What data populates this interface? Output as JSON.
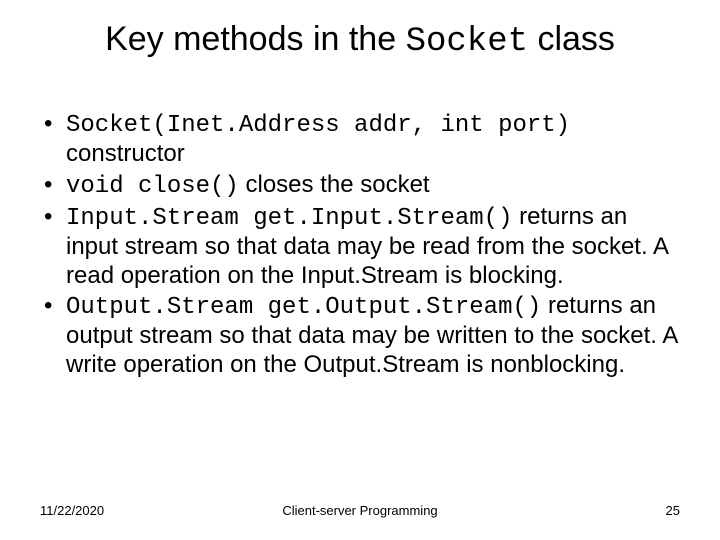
{
  "title": {
    "pre": "Key methods in the ",
    "code": "Socket",
    "post": " class"
  },
  "bullets": [
    {
      "code": "Socket(Inet.Address addr, int port)",
      "text": " constructor"
    },
    {
      "code": "void close()",
      "text": " closes the socket"
    },
    {
      "code": "Input.Stream get.Input.Stream()",
      "text": " returns an input stream so that data may be read from the socket. A read operation on the Input.Stream is blocking."
    },
    {
      "code": "Output.Stream get.Output.Stream()",
      "text": " returns an output stream so that data may be written to the socket. A write operation on the Output.Stream is nonblocking."
    }
  ],
  "footer": {
    "date": "11/22/2020",
    "center": "Client-server Programming",
    "page": "25"
  }
}
